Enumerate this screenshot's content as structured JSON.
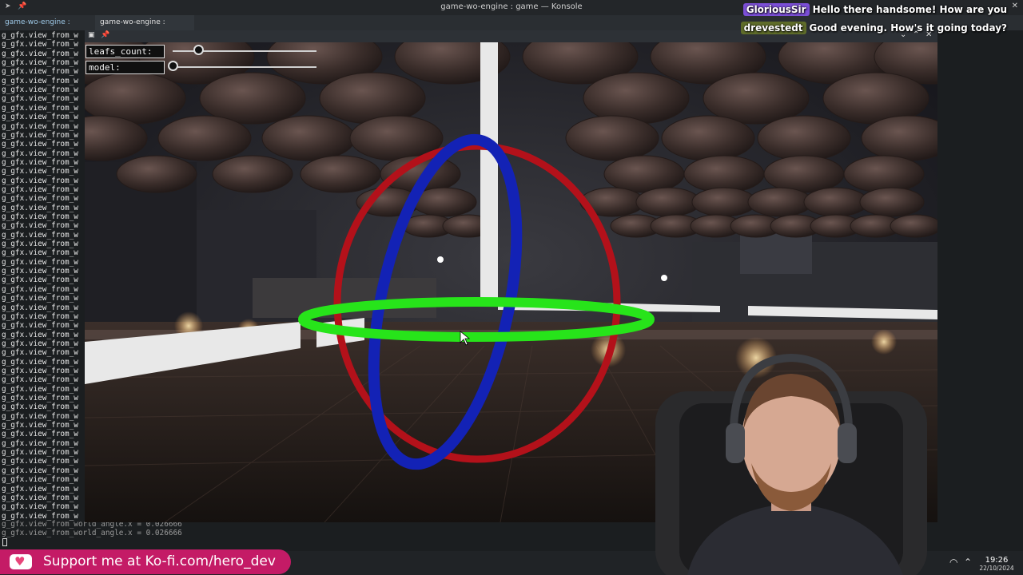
{
  "window": {
    "title": "game-wo-engine : game — Konsole"
  },
  "tabs": [
    {
      "label": "game-wo-engine : helix",
      "close": "×"
    },
    {
      "label": "game-wo-engine : game",
      "close": "×"
    }
  ],
  "terminal": {
    "repeated_line": "g_gfx.view_from_w",
    "repeat_count": 54,
    "tail_lines": [
      "g_gfx.view_from_world_angle.x = 0.026666",
      "g_gfx.view_from_world_angle.x = 0.026666"
    ]
  },
  "game": {
    "fields": [
      {
        "label": "leafs_count:",
        "slider_value": 0.18
      },
      {
        "label": "model:",
        "slider_value": 0.0
      }
    ]
  },
  "chat": [
    {
      "user": "GloriousSir",
      "user_color": "#7b4fd6",
      "message": "Hello there handsome! How are you"
    },
    {
      "user": "drevestedt",
      "user_color": "#5f6c2a",
      "message": "Good evening. How's it going today?"
    }
  ],
  "kofi": {
    "label": "Support me at Ko-fi.com/hero_dev",
    "color": "#c41b66"
  },
  "taskbar": {
    "time": "19:26",
    "date": "22/10/2024"
  },
  "icons": {
    "pin": "pin-icon",
    "close": "close-icon",
    "wifi": "wifi-icon",
    "tray_up": "chevron-up-icon"
  }
}
